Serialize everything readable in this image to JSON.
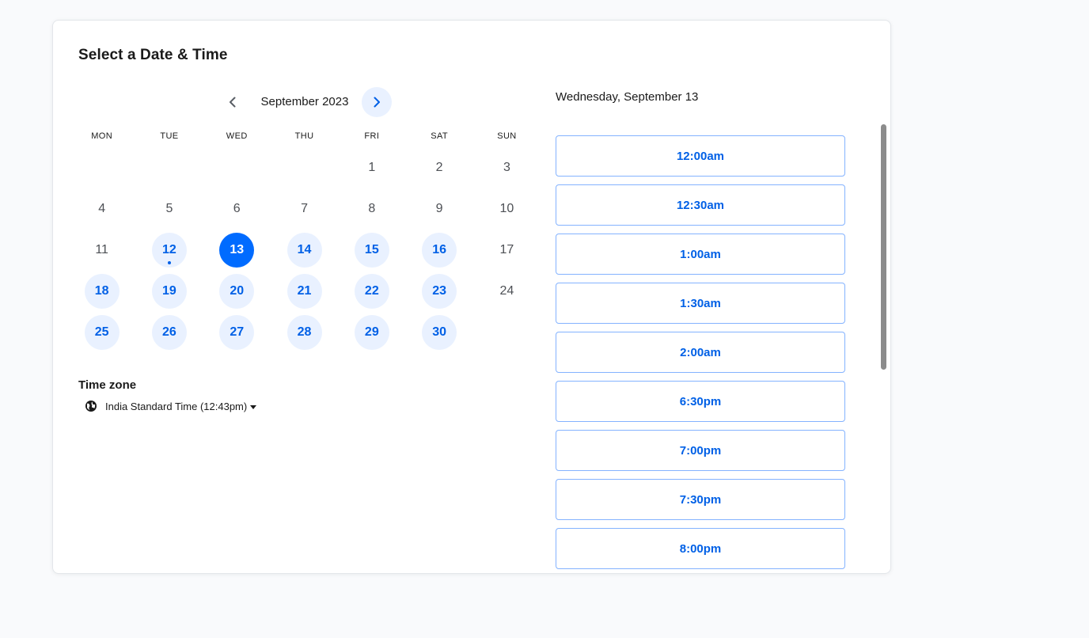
{
  "title": "Select a Date & Time",
  "calendar": {
    "month_label": "September 2023",
    "weekdays": [
      "MON",
      "TUE",
      "WED",
      "THU",
      "FRI",
      "SAT",
      "SUN"
    ],
    "weeks": [
      [
        {
          "d": ""
        },
        {
          "d": ""
        },
        {
          "d": ""
        },
        {
          "d": ""
        },
        {
          "d": "1"
        },
        {
          "d": "2"
        },
        {
          "d": "3"
        }
      ],
      [
        {
          "d": "4"
        },
        {
          "d": "5"
        },
        {
          "d": "6"
        },
        {
          "d": "7"
        },
        {
          "d": "8"
        },
        {
          "d": "9"
        },
        {
          "d": "10"
        }
      ],
      [
        {
          "d": "11"
        },
        {
          "d": "12",
          "avail": true,
          "today": true
        },
        {
          "d": "13",
          "avail": true,
          "selected": true
        },
        {
          "d": "14",
          "avail": true
        },
        {
          "d": "15",
          "avail": true
        },
        {
          "d": "16",
          "avail": true
        },
        {
          "d": "17"
        }
      ],
      [
        {
          "d": "18",
          "avail": true
        },
        {
          "d": "19",
          "avail": true
        },
        {
          "d": "20",
          "avail": true
        },
        {
          "d": "21",
          "avail": true
        },
        {
          "d": "22",
          "avail": true
        },
        {
          "d": "23",
          "avail": true
        },
        {
          "d": "24"
        }
      ],
      [
        {
          "d": "25",
          "avail": true
        },
        {
          "d": "26",
          "avail": true
        },
        {
          "d": "27",
          "avail": true
        },
        {
          "d": "28",
          "avail": true
        },
        {
          "d": "29",
          "avail": true
        },
        {
          "d": "30",
          "avail": true
        },
        {
          "d": ""
        }
      ]
    ]
  },
  "timezone": {
    "label": "Time zone",
    "value": "India Standard Time (12:43pm)"
  },
  "selected_date_heading": "Wednesday, September 13",
  "time_slots": [
    "12:00am",
    "12:30am",
    "1:00am",
    "1:30am",
    "2:00am",
    "6:30pm",
    "7:00pm",
    "7:30pm",
    "8:00pm"
  ],
  "icons": {
    "prev": "chevron-left-icon",
    "next": "chevron-right-icon",
    "timezone": "globe-icon",
    "dropdown": "caret-down-icon"
  },
  "colors": {
    "accent": "#006bff",
    "accent_text": "#0060e6",
    "accent_bg": "#e9f1ff",
    "slot_border": "#84b3ff"
  }
}
